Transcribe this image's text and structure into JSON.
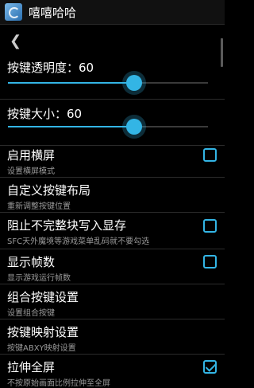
{
  "app": {
    "title": "嘻嘻哈哈"
  },
  "sliders": [
    {
      "label_prefix": "按键透明度：",
      "value": "60",
      "fraction": 0.63
    },
    {
      "label_prefix": "按键大小：",
      "value": "60",
      "fraction": 0.63
    }
  ],
  "settings": [
    {
      "title": "启用横屏",
      "subtitle": "设置横屏模式",
      "has_checkbox": true,
      "checked": false
    },
    {
      "title": "自定义按键布局",
      "subtitle": "重新调整按键位置",
      "has_checkbox": false
    },
    {
      "title": "阻止不完整块写入显存",
      "subtitle": "SFC天外魔境等游戏菜单乱码就不要勾选",
      "has_checkbox": true,
      "checked": false
    },
    {
      "title": "显示帧数",
      "subtitle": "显示游戏运行帧数",
      "has_checkbox": true,
      "checked": false
    },
    {
      "title": "组合按键设置",
      "subtitle": "设置组合按键",
      "has_checkbox": false
    },
    {
      "title": "按键映射设置",
      "subtitle": "按键ABXY映射设置",
      "has_checkbox": false
    },
    {
      "title": "拉伸全屏",
      "subtitle": "不按原始画面比例拉伸至全屏",
      "has_checkbox": true,
      "checked": true
    }
  ],
  "colors": {
    "accent": "#33b5e5",
    "background": "#000000"
  },
  "icons": {
    "back": "chevron-left-icon",
    "app": "app-logo-icon"
  }
}
